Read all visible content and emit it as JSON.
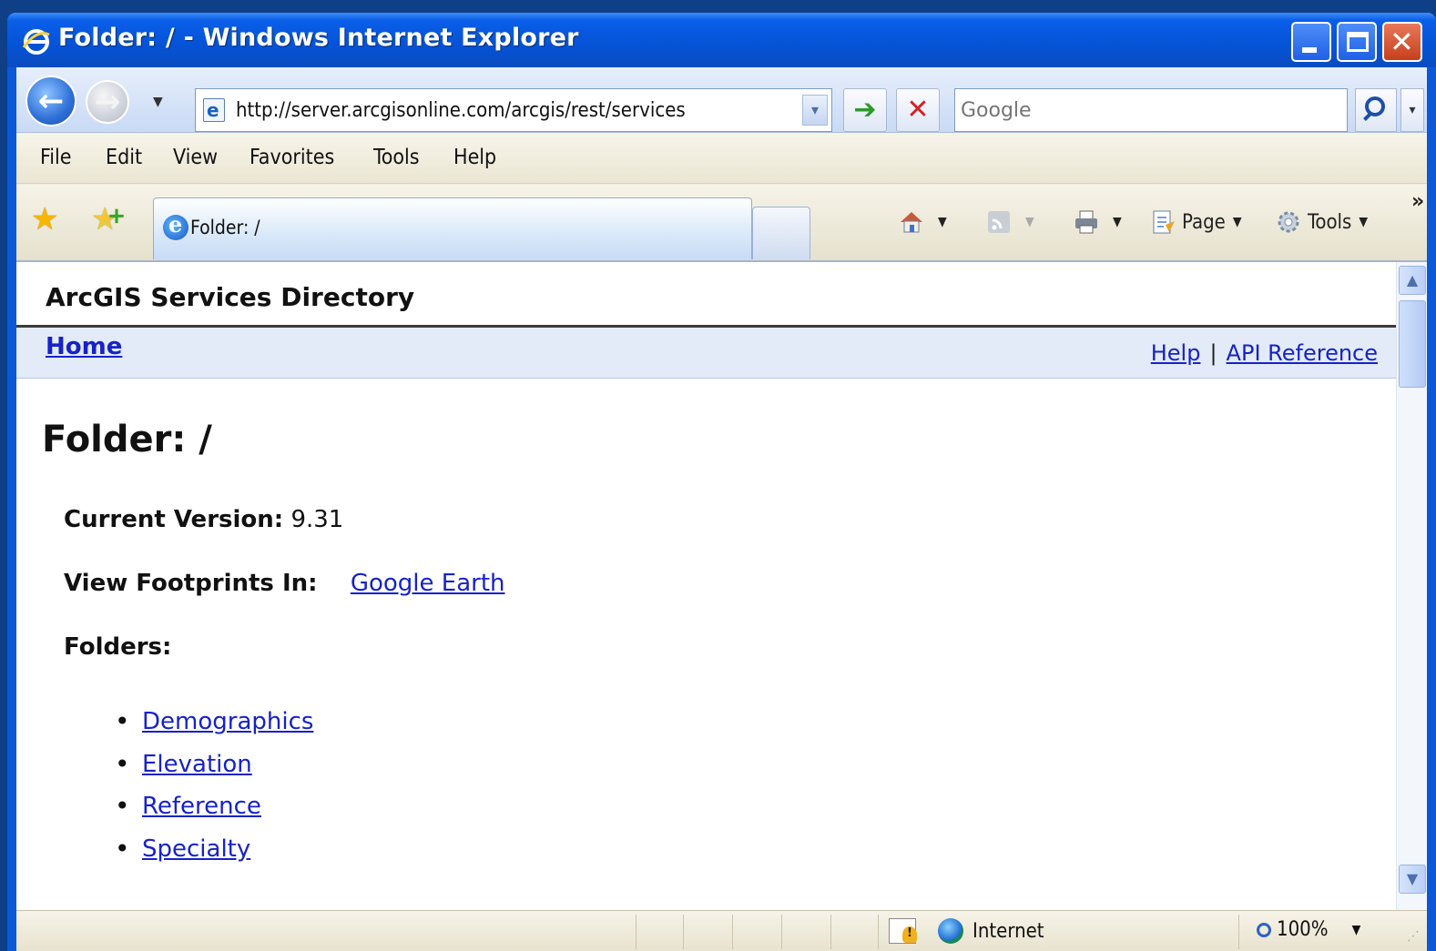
{
  "window": {
    "title": "Folder: / - Windows Internet Explorer",
    "controls": {
      "minimize": "minimize",
      "maximize": "maximize",
      "close": "✕"
    }
  },
  "toolbar": {
    "address": "http://server.arcgisonline.com/arcgis/rest/services",
    "search_placeholder": "Google",
    "go_glyph": "➔",
    "stop_glyph": "✕"
  },
  "menu": {
    "items": [
      {
        "label": "File"
      },
      {
        "label": "Edit"
      },
      {
        "label": "View"
      },
      {
        "label": "Favorites"
      },
      {
        "label": "Tools"
      },
      {
        "label": "Help"
      }
    ]
  },
  "tabs": {
    "active_label": "Folder: /"
  },
  "commandbar": {
    "page_label": "Page",
    "tools_label": "Tools",
    "overflow": "»"
  },
  "page": {
    "header_title": "ArcGIS Services Directory",
    "nav": {
      "home": "Home",
      "help": "Help",
      "separator": "|",
      "api_reference": "API Reference"
    },
    "folder_title": "Folder: /",
    "current_version_label": "Current Version:",
    "current_version_value": "9.31",
    "view_footprints_label": "View Footprints In:",
    "view_footprints_link": "Google Earth",
    "folders_label": "Folders:",
    "folders": [
      "Demographics",
      "Elevation",
      "Reference",
      "Specialty"
    ]
  },
  "statusbar": {
    "zone": "Internet",
    "zoom": "100%"
  },
  "colors": {
    "titlebar": "#0553d6",
    "link": "#1722c8",
    "navbar_bg": "#e2ebf7",
    "desktop": "#0f3f87"
  }
}
